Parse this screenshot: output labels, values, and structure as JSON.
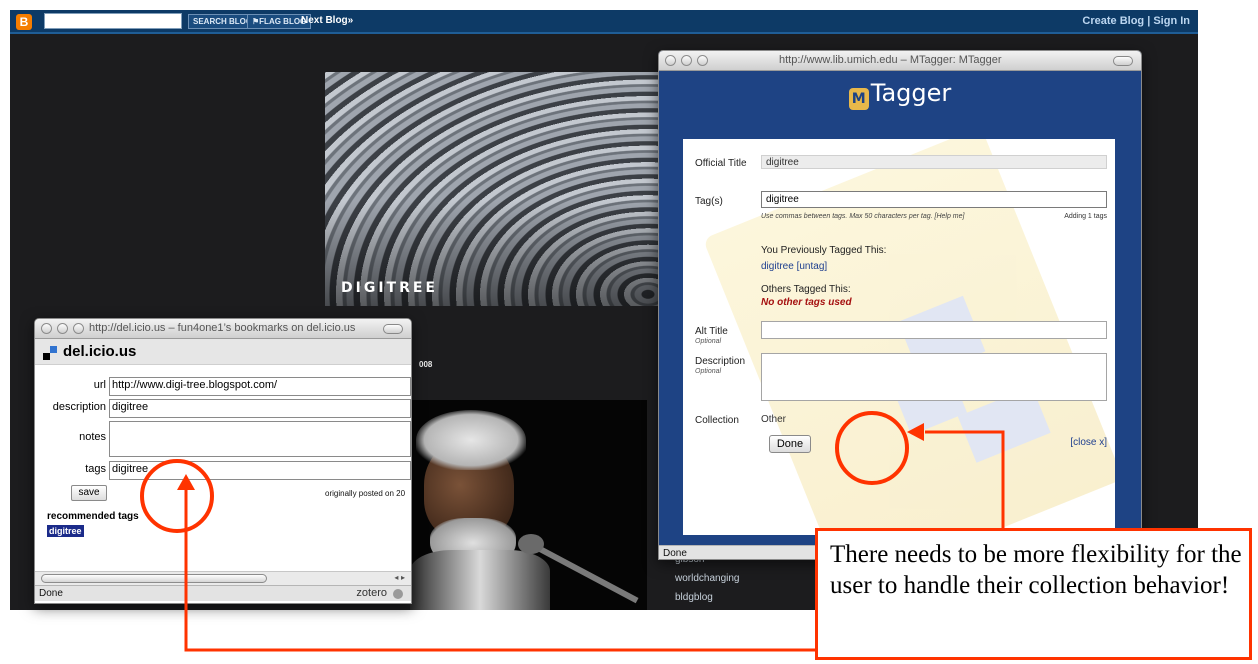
{
  "navbar": {
    "logo": "B",
    "search_button": "SEARCH BLOG",
    "flag_button": "⚑FLAG BLOG",
    "next_blog": "Next Blog»",
    "right_links": "Create Blog | Sign In"
  },
  "blog": {
    "title": "DIGITREE",
    "date_fragment": "008",
    "sidebar_links": [
      "gibson",
      "worldchanging",
      "bldgblog"
    ]
  },
  "delicious": {
    "window_title": "http://del.icio.us – fun4one1’s bookmarks on del.icio.us",
    "brand": "del.icio.us",
    "fields": {
      "url_label": "url",
      "url_value": "http://www.digi-tree.blogspot.com/",
      "description_label": "description",
      "description_value": "digitree",
      "notes_label": "notes",
      "notes_value": "",
      "tags_label": "tags",
      "tags_value": "digitree"
    },
    "save_label": "save",
    "posted_text": "originally posted on 20",
    "recommended_label": "recommended tags",
    "recommended_tag": "digitree",
    "status": "Done",
    "zotero": "zotero",
    "scroll_arrows": "◂ ▸"
  },
  "mtagger": {
    "window_title": "http://www.lib.umich.edu – MTagger: MTagger",
    "badge": "M",
    "brand": "Tagger",
    "official_title_label": "Official Title",
    "official_title_value": "digitree",
    "tags_label": "Tag(s)",
    "tags_value": "digitree",
    "tags_hint": "Use commas between tags. Max 50 characters per tag. [Help me]",
    "tags_count": "Adding 1 tags",
    "prev_heading": "You Previously Tagged This:",
    "prev_tag": "digitree",
    "untag": "[untag]",
    "others_heading": "Others Tagged This:",
    "others_none": "No other tags used",
    "alt_title_label": "Alt Title",
    "optional": "Optional",
    "description_label": "Description",
    "collection_label": "Collection",
    "collection_value": "Other",
    "done_button": "Done",
    "close_link": "[close x]",
    "status": "Done"
  },
  "annotation": {
    "callout": "There needs to be more flexibility for the user to handle their collection behavior!",
    "color": "#ff3300"
  }
}
